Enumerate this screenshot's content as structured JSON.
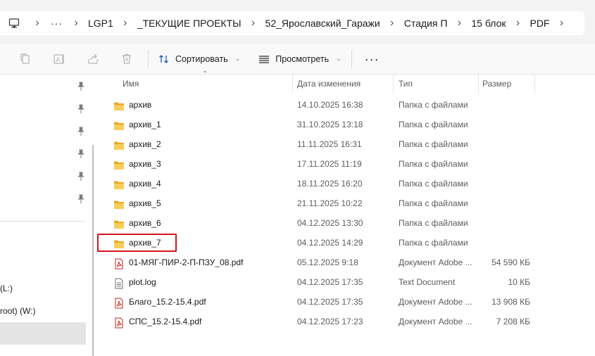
{
  "breadcrumbs": [
    "LGP1",
    "_ТЕКУЩИЕ ПРОЕКТЫ",
    "52_Ярославский_Гаражи",
    "Стадия П",
    "15 блок",
    "PDF"
  ],
  "toolbar": {
    "sort_label": "Сортировать",
    "view_label": "Просмотреть"
  },
  "nav": {
    "drive_l": "(L:)",
    "drive_w": "root) (W:)"
  },
  "columns": {
    "name": "Имя",
    "date": "Дата изменения",
    "type": "Тип",
    "size": "Размер"
  },
  "files": [
    {
      "icon": "folder-icon",
      "name": "архив",
      "date": "14.10.2025 16:38",
      "type": "Папка с файлами",
      "size": ""
    },
    {
      "icon": "folder-icon",
      "name": "архив_1",
      "date": "31.10.2025 13:18",
      "type": "Папка с файлами",
      "size": ""
    },
    {
      "icon": "folder-icon",
      "name": "архив_2",
      "date": "11.11.2025 16:31",
      "type": "Папка с файлами",
      "size": ""
    },
    {
      "icon": "folder-icon",
      "name": "архив_3",
      "date": "17.11.2025 11:19",
      "type": "Папка с файлами",
      "size": ""
    },
    {
      "icon": "folder-icon",
      "name": "архив_4",
      "date": "18.11.2025 16:20",
      "type": "Папка с файлами",
      "size": ""
    },
    {
      "icon": "folder-icon",
      "name": "архив_5",
      "date": "21.11.2025 10:22",
      "type": "Папка с файлами",
      "size": ""
    },
    {
      "icon": "folder-icon",
      "name": "архив_6",
      "date": "04.12.2025 13:30",
      "type": "Папка с файлами",
      "size": ""
    },
    {
      "icon": "folder-icon",
      "name": "архив_7",
      "date": "04.12.2025 14:29",
      "type": "Папка с файлами",
      "size": ""
    },
    {
      "icon": "pdf-icon",
      "name": "01-МЯГ-ПИР-2-П-ПЗУ_08.pdf",
      "date": "05.12.2025 9:18",
      "type": "Документ Adobe ...",
      "size": "54 590 КБ"
    },
    {
      "icon": "text-file-icon",
      "name": "plot.log",
      "date": "04.12.2025 17:35",
      "type": "Text Document",
      "size": "10 КБ"
    },
    {
      "icon": "pdf-icon",
      "name": "Благо_15.2-15.4.pdf",
      "date": "04.12.2025 17:35",
      "type": "Документ Adobe ...",
      "size": "13 908 КБ"
    },
    {
      "icon": "pdf-icon",
      "name": "СПС_15.2-15.4.pdf",
      "date": "04.12.2025 17:23",
      "type": "Документ Adobe ...",
      "size": "7 208 КБ"
    }
  ],
  "colors": {
    "highlight": "#d6141d",
    "folder": "#f2c04a",
    "pdf": "#c8201e"
  }
}
